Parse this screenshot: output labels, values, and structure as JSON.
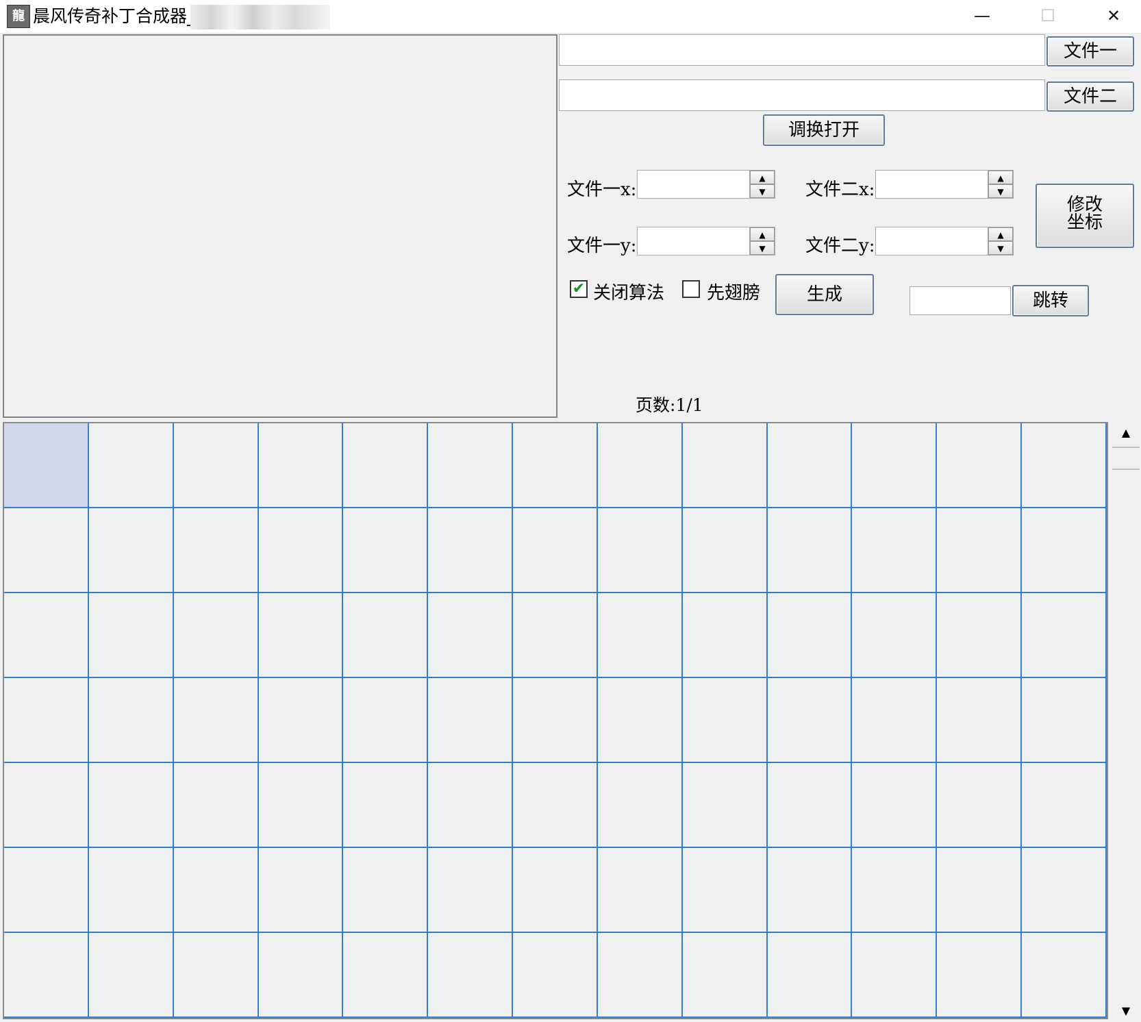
{
  "window": {
    "title": "晨风传奇补丁合成器_",
    "icon_name": "app-icon",
    "icon_glyph": "龍",
    "controls": {
      "minimize": "—",
      "maximize": "☐",
      "close": "✕"
    }
  },
  "files": {
    "file1_path": "",
    "file1_button": "文件一",
    "file2_path": "",
    "file2_button": "文件二",
    "swap_open_button": "调换打开"
  },
  "coords": {
    "file1_x_label": "文件一x:",
    "file1_x_value": "",
    "file1_y_label": "文件一y:",
    "file1_y_value": "",
    "file2_x_label": "文件二x:",
    "file2_x_value": "",
    "file2_y_label": "文件二y:",
    "file2_y_value": "",
    "modify_button_line1": "修改",
    "modify_button_line2": "坐标",
    "spin_up_glyph": "▲",
    "spin_down_glyph": "▼"
  },
  "options": {
    "close_algorithm_label": "关闭算法",
    "close_algorithm_checked": true,
    "check_glyph": "✔",
    "wings_first_label": "先翅膀",
    "wings_first_checked": false,
    "generate_button": "生成",
    "jump_value": "",
    "jump_button": "跳转"
  },
  "pagination": {
    "page_label": "页数:1/1"
  },
  "grid": {
    "columns": 13,
    "rows": 7,
    "selected_index": 0,
    "line_color": "#2f7ed1",
    "selected_color": "#d2d6ec"
  },
  "scrollbar": {
    "up_glyph": "▲",
    "down_glyph": "▼"
  }
}
